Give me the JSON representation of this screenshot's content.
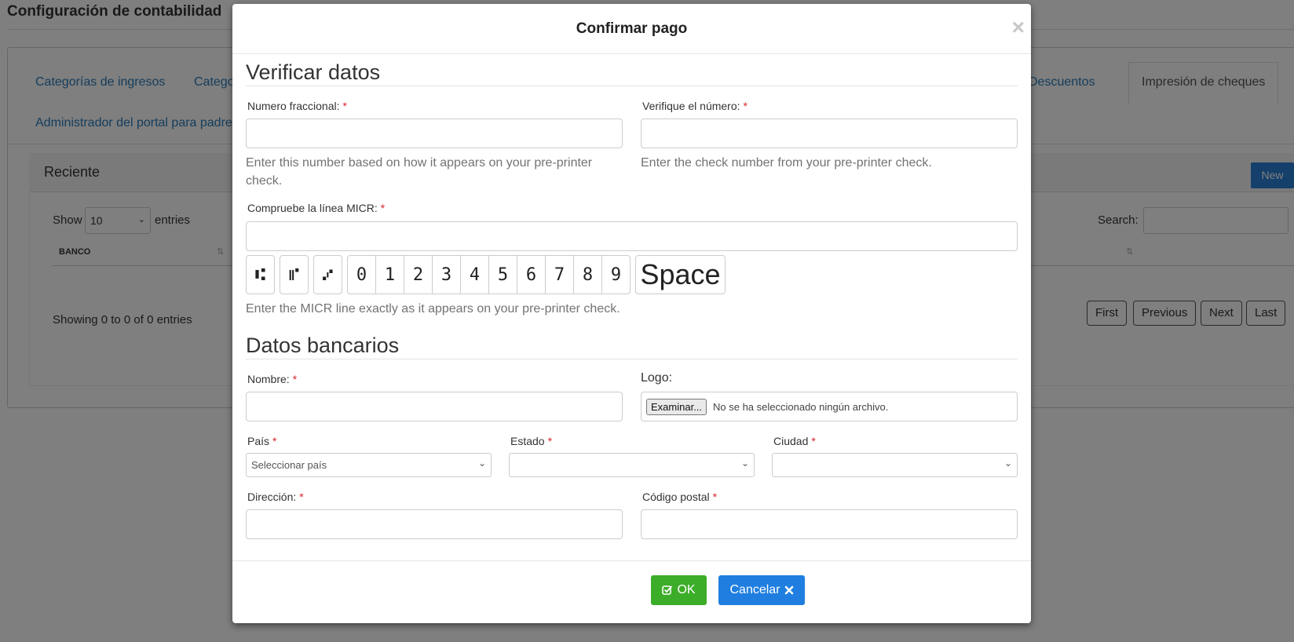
{
  "background": {
    "page_title": "Configuración de contabilidad",
    "tabs": [
      "Categorías de ingresos",
      "Categor",
      "Descuentos",
      "Impresión de cheques",
      "Administrador del portal para padres"
    ],
    "panel_title": "Reciente",
    "new_button": "New",
    "show_label": "Show",
    "page_length": "10",
    "entries_label": "entries",
    "search_label": "Search:",
    "column_bank": "BANCO",
    "info": "Showing 0 to 0 of 0 entries",
    "pagination": [
      "First",
      "Previous",
      "Next",
      "Last"
    ]
  },
  "modal": {
    "title": "Confirmar pago",
    "close_symbol": "×",
    "verify_section": {
      "title": "Verificar datos",
      "fractional_label": "Numero fraccional:",
      "fractional_help": "Enter this number based on how it appears on your pre-printer check.",
      "check_number_label": "Verifique el número:",
      "check_number_help": "Enter the check number from your pre-printer check.",
      "micr_label": "Compruebe la línea MICR:",
      "micr_keys": [
        "⑆",
        "⑈",
        "⑇",
        "0",
        "1",
        "2",
        "3",
        "4",
        "5",
        "6",
        "7",
        "8",
        "9"
      ],
      "space_key": "Space",
      "micr_help": "Enter the MICR line exactly as it appears on your pre-printer check."
    },
    "bank_section": {
      "title": "Datos bancarios",
      "name_label": "Nombre:",
      "logo_label": "Logo:",
      "file_button": "Examinar...",
      "file_status": "No se ha seleccionado ningún archivo.",
      "country_label": "País",
      "country_value": "Seleccionar país",
      "state_label": "Estado",
      "city_label": "Ciudad",
      "address_label": "Dirección:",
      "postal_label": "Código postal"
    },
    "required_mark": "*",
    "ok_label": "OK",
    "cancel_label": "Cancelar"
  },
  "colors": {
    "ok_button": "#3cad28",
    "cancel_button": "#1f7ee0",
    "required": "#d9232d",
    "link": "#2a7ab8"
  }
}
